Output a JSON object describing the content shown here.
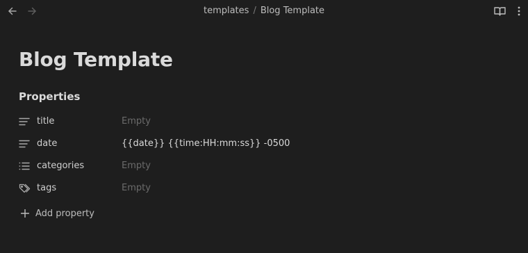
{
  "header": {
    "breadcrumb": [
      "templates",
      "Blog Template"
    ],
    "breadcrumb_separator": "/",
    "icons": {
      "back": "arrow-left-icon",
      "forward": "arrow-right-icon",
      "reading_view": "book-open-icon",
      "more": "more-vertical-icon"
    }
  },
  "note": {
    "title": "Blog Template"
  },
  "properties": {
    "heading": "Properties",
    "items": [
      {
        "key": "title",
        "value": "Empty",
        "is_empty": true,
        "icon": "text-lines-icon"
      },
      {
        "key": "date",
        "value": "{{date}} {{time:HH:mm:ss}} -0500",
        "is_empty": false,
        "icon": "text-lines-icon"
      },
      {
        "key": "categories",
        "value": "Empty",
        "is_empty": true,
        "icon": "list-icon"
      },
      {
        "key": "tags",
        "value": "Empty",
        "is_empty": true,
        "icon": "tags-icon"
      }
    ],
    "add_label": "Add property"
  },
  "colors": {
    "background": "#1e1e1e",
    "text": "#dadada",
    "muted": "#6b6b6b",
    "icon": "#a8a8a8"
  }
}
